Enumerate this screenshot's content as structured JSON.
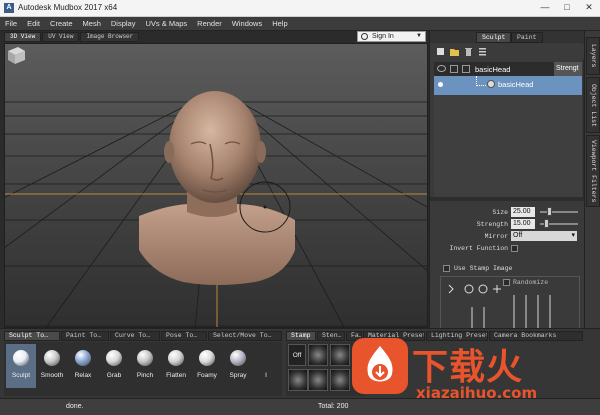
{
  "window": {
    "title": "Autodesk Mudbox 2017 x64",
    "app_icon_letter": "A",
    "minimize": "—",
    "maximize": "□",
    "close": "✕"
  },
  "menu": [
    "File",
    "Edit",
    "Create",
    "Mesh",
    "Display",
    "UVs & Maps",
    "Render",
    "Windows",
    "Help"
  ],
  "view_tabs": [
    "3D View",
    "UV View",
    "Image Browser"
  ],
  "sign_in": {
    "label": "Sign In",
    "caret": "▼"
  },
  "right_tabs": [
    "Sculpt",
    "Paint"
  ],
  "layers": {
    "header_name": "basicHead",
    "strength_header": "Strengt",
    "row_name": "basicHead"
  },
  "properties": {
    "size_label": "Size",
    "size_value": "25.00",
    "strength_label": "Strength",
    "strength_value": "15.00",
    "mirror_label": "Mirror",
    "mirror_value": "Off",
    "invert_label": "Invert Function",
    "use_stamp_label": "Use Stamp Image",
    "randomize_label": "Randomize"
  },
  "side_tabs": [
    "Layers",
    "Object List",
    "Viewport Filters"
  ],
  "tool_tabs": [
    "Sculpt To…",
    "Paint To…",
    "Curve To…",
    "Pose To…",
    "Select/Move To…"
  ],
  "stamp_tabs": [
    "Stamp",
    "Sten…",
    "Fa…",
    "Material Presets",
    "Lighting Presets",
    "Camera Bookmarks"
  ],
  "tools": [
    {
      "label": "Sculpt",
      "color": "#e8eef5"
    },
    {
      "label": "Smooth",
      "color": "#c9c9c9"
    },
    {
      "label": "Relax",
      "color": "#8aa7d4"
    },
    {
      "label": "Grab",
      "color": "#d8d8d8"
    },
    {
      "label": "Pinch",
      "color": "#c6c6c6"
    },
    {
      "label": "Flatten",
      "color": "#d4d4d4"
    },
    {
      "label": "Foamy",
      "color": "#dcdcdc"
    },
    {
      "label": "Spray",
      "color": "#b8b8c8"
    },
    {
      "label": "I"
    }
  ],
  "stamp": {
    "off_label": "Off"
  },
  "status": {
    "message": "done.",
    "total": "Total: 200"
  },
  "watermark": {
    "chinese": "下载火",
    "url": "xiazaihuo.com"
  }
}
